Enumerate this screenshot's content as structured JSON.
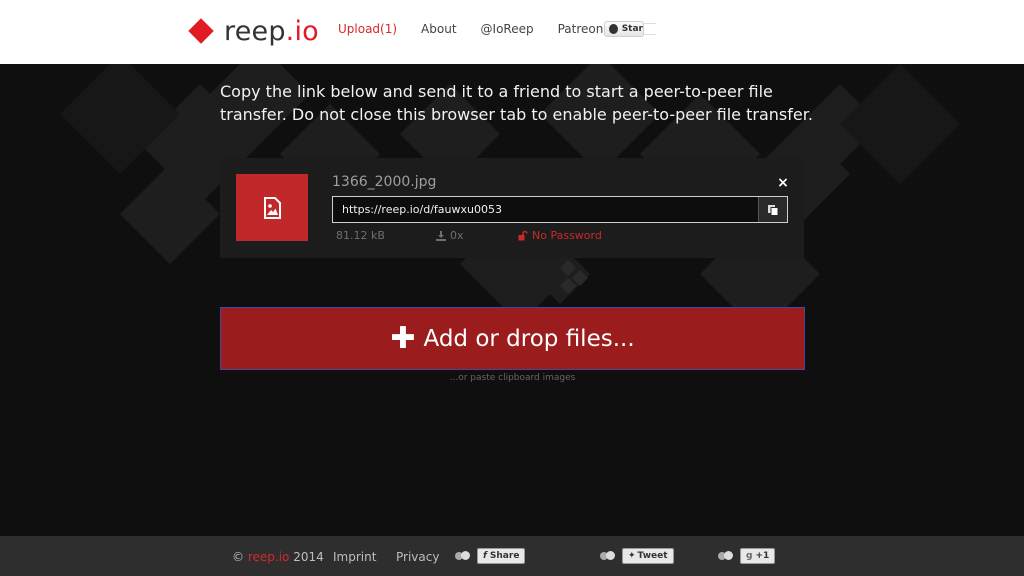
{
  "header": {
    "logo": {
      "name": "reep",
      "ext": ".io"
    },
    "nav": [
      {
        "label": "Upload(1)",
        "active": true
      },
      {
        "label": "About",
        "active": false
      },
      {
        "label": "@IoReep",
        "active": false
      },
      {
        "label": "Patreon",
        "active": false
      }
    ],
    "github_star_label": "Star"
  },
  "intro_text": "Copy the link below and send it to a friend to start a peer-to-peer file transfer. Do not close this browser tab to enable peer-to-peer file transfer.",
  "file": {
    "name": "1366_2000.jpg",
    "link": "https://reep.io/d/fauwxu0053",
    "size": "81.12 kB",
    "downloads": "0x",
    "password_status": "No Password",
    "close_symbol": "×"
  },
  "upload": {
    "add_label": "Add or drop files...",
    "paste_hint": "...or paste clipboard images"
  },
  "footer": {
    "copyright_symbol": "©",
    "brand": "reep.io",
    "year": "2014",
    "imprint": "Imprint",
    "privacy": "Privacy",
    "share": {
      "facebook": "Share",
      "twitter": "Tweet",
      "gplus": "+1"
    }
  },
  "colors": {
    "accent": "#e01b24",
    "add_button": "#9a1c1c",
    "card_bg": "#1c1c1c",
    "page_bg": "#0f0f0f",
    "footer_bg": "#2e2e2e"
  }
}
